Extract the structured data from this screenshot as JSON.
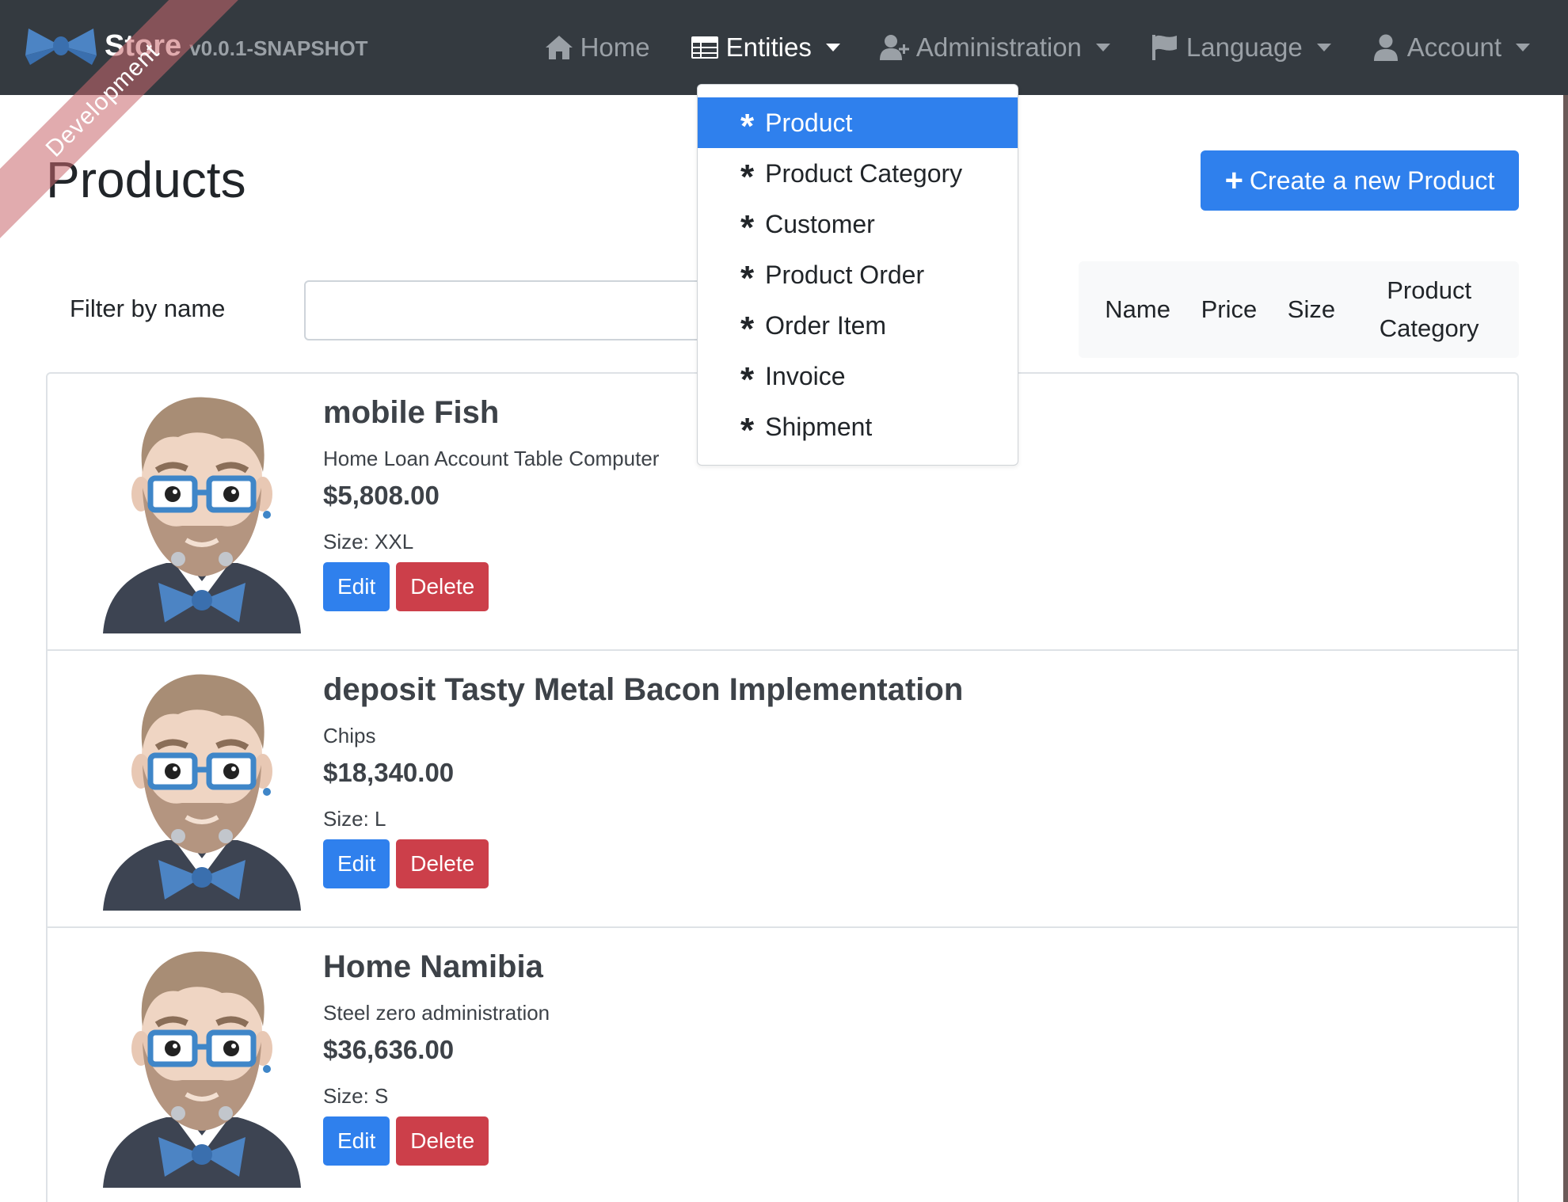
{
  "navbar": {
    "brand_title": "Store",
    "brand_version": "v0.0.1-SNAPSHOT",
    "ribbon": "Development",
    "items": [
      {
        "label": "Home",
        "icon": "home-icon"
      },
      {
        "label": "Entities",
        "icon": "table-icon",
        "active": true
      },
      {
        "label": "Administration",
        "icon": "user-plus-icon"
      },
      {
        "label": "Language",
        "icon": "flag-icon"
      },
      {
        "label": "Account",
        "icon": "user-icon"
      }
    ]
  },
  "entities_menu": {
    "items": [
      "Product",
      "Product Category",
      "Customer",
      "Product Order",
      "Order Item",
      "Invoice",
      "Shipment"
    ],
    "selected": "Product",
    "icon": "asterisk-icon"
  },
  "page": {
    "title": "Products",
    "create_button": "Create a new Product"
  },
  "filter": {
    "label": "Filter by name",
    "value": ""
  },
  "sort": {
    "name": "Name",
    "price": "Price",
    "size": "Size",
    "category": "Product Category"
  },
  "products": [
    {
      "name": "mobile Fish",
      "description": "Home Loan Account Table Computer",
      "price": "$5,808.00",
      "size": "Size: XXL",
      "edit": "Edit",
      "delete": "Delete"
    },
    {
      "name": "deposit Tasty Metal Bacon Implementation",
      "description": "Chips",
      "price": "$18,340.00",
      "size": "Size: L",
      "edit": "Edit",
      "delete": "Delete"
    },
    {
      "name": "Home Namibia",
      "description": "Steel zero administration",
      "price": "$36,636.00",
      "size": "Size: S",
      "edit": "Edit",
      "delete": "Delete"
    }
  ],
  "colors": {
    "navbar": "#343a40",
    "primary": "#2f80ed",
    "danger": "#cc3f4a",
    "ribbon": "#c9666b"
  }
}
